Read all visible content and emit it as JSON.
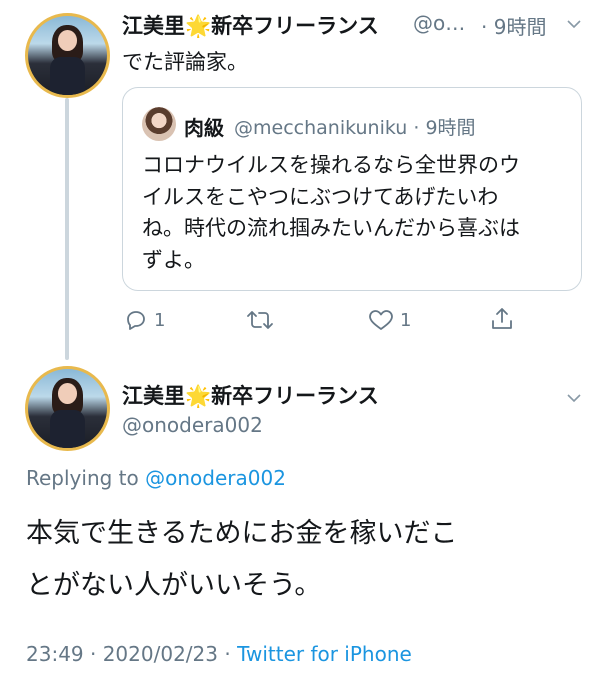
{
  "top_tweet": {
    "name": "江美里🌟新卒フリーランス",
    "handle": "@o…",
    "time": "· 9時間",
    "text": "でた評論家。"
  },
  "quoted_tweet": {
    "name": "肉級",
    "handle_time": "@mecchanikuniku · 9時間",
    "text_lines": [
      "コロナウイルスを操れるなら全世界のウ",
      "イルスをこやつにぶつけてあげたいわ",
      "ね。時代の流れ掴みたいんだから喜ぶは",
      "ずよ。"
    ]
  },
  "actions": {
    "reply_count": "1",
    "like_count": "1"
  },
  "main_tweet": {
    "name": "江美里🌟新卒フリーランス",
    "handle": "@onodera002",
    "replying_prefix": "Replying to",
    "replying_handle": "@onodera002",
    "text_lines": [
      "本気で生きるためにお金を稼いだこ",
      "とがない人がいいそう。"
    ],
    "timestamp": "23:49 · 2020/02/23 ·",
    "source": "Twitter for iPhone"
  },
  "colors": {
    "link": "#1b95e0",
    "secondary": "#657786",
    "border": "#ccd6dd",
    "avatar_ring": "#e8b94d"
  }
}
